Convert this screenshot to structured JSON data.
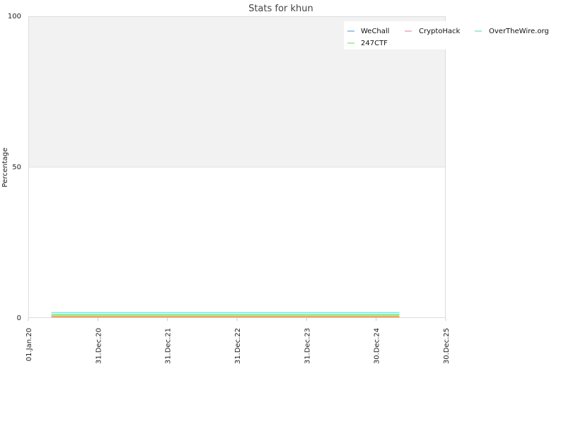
{
  "chart_data": {
    "type": "line",
    "title": "Stats for khun",
    "xlabel": "",
    "ylabel": "Percentage",
    "ylim": [
      0,
      100
    ],
    "y_ticks": [
      "0",
      "50",
      "100"
    ],
    "x_tick_labels": [
      "01.Jan.20",
      "31.Dec.20",
      "31.Dec.21",
      "31.Dec.22",
      "31.Dec.23",
      "30.Dec.24",
      "30.Dec.25"
    ],
    "xlim": [
      "2020-01-01",
      "2025-12-30"
    ],
    "grid": true,
    "legend_position": "top-right",
    "series": [
      {
        "name": "WeChall",
        "color": "#7cb5ec",
        "x": [
          "2020-05-01",
          "2025-05-01"
        ],
        "values": [
          0.5,
          0.5
        ]
      },
      {
        "name": "CryptoHack",
        "color": "#f7a35c",
        "x": [
          "2020-05-01",
          "2025-05-01"
        ],
        "values": [
          0.5,
          0.5
        ]
      },
      {
        "name": "OverTheWire.org",
        "color": "#7ee8d8",
        "x": [
          "2020-05-01",
          "2025-05-01"
        ],
        "values": [
          1.8,
          1.8
        ]
      },
      {
        "name": "247CTF",
        "color": "#90ed7d",
        "x": [
          "2020-05-01",
          "2025-05-01"
        ],
        "values": [
          1.2,
          1.2
        ]
      }
    ],
    "legend_colors": {
      "WeChall": "#7cb5ec",
      "CryptoHack": "#f4a4b4",
      "OverTheWire.org": "#7ee8d8",
      "247CTF": "#90ed7d"
    },
    "band_color": "#f2f2f2",
    "plot_border_color": "#dddddd"
  }
}
